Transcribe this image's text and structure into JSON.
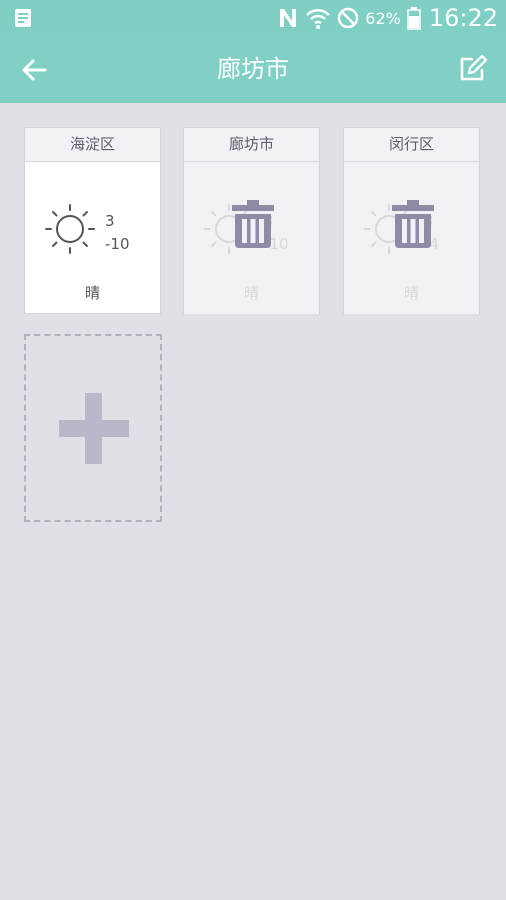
{
  "statusbar": {
    "battery": "62%",
    "time": "16:22"
  },
  "header": {
    "title": "廊坊市"
  },
  "cities": [
    {
      "name": "海淀区",
      "high": "3",
      "low": "-10",
      "condition": "晴",
      "delete_mode": false
    },
    {
      "name": "廊坊市",
      "high": "3",
      "low": "-10",
      "condition": "晴",
      "delete_mode": true
    },
    {
      "name": "闵行区",
      "high": "3",
      "low": "-4",
      "condition": "晴",
      "delete_mode": true
    }
  ],
  "colors": {
    "accent": "#80d0c5",
    "background": "#e1e0e6",
    "trash": "#8e8ba6",
    "plus": "#b9b8cb"
  }
}
